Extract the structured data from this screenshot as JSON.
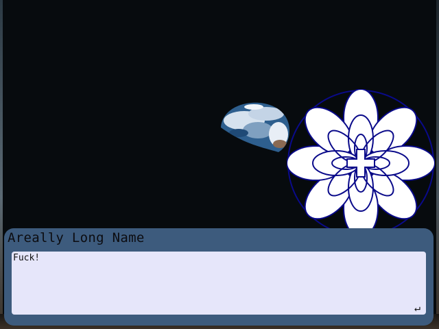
{
  "dialogue_box": {
    "speaker_name": "Areally Long Name",
    "text": "Fuck!",
    "advance_glyph": "↵"
  },
  "scene": {
    "background": "earthrise-over-moon",
    "emblem": "flower-emblem-icon"
  },
  "colors": {
    "box": "#3d5b7d",
    "text_area": "#e6e6fa",
    "emblem_stroke": "#0a0a8a"
  }
}
